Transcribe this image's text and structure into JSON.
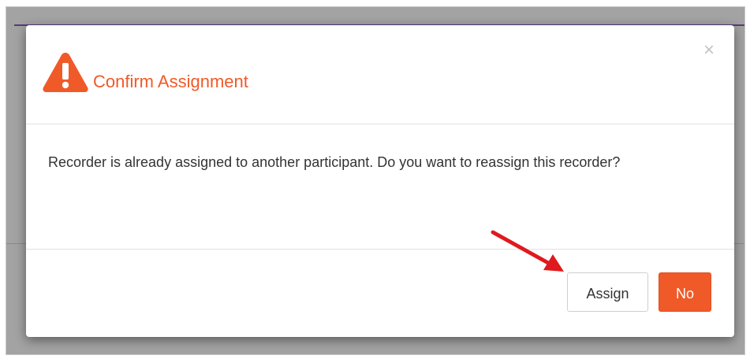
{
  "modal": {
    "title": "Confirm Assignment",
    "close_glyph": "×",
    "message": "Recorder is already assigned to another participant. Do you want to reassign this recorder?",
    "buttons": {
      "assign_label": "Assign",
      "no_label": "No"
    },
    "icons": {
      "title_icon": "warning-triangle-icon",
      "close_icon": "close-icon"
    }
  },
  "annotation": {
    "type": "red-arrow",
    "points_to": "Assign"
  },
  "colors": {
    "accent": "#f05a28",
    "annotation": "#e0191e",
    "overlay": "#a3a3a3"
  }
}
